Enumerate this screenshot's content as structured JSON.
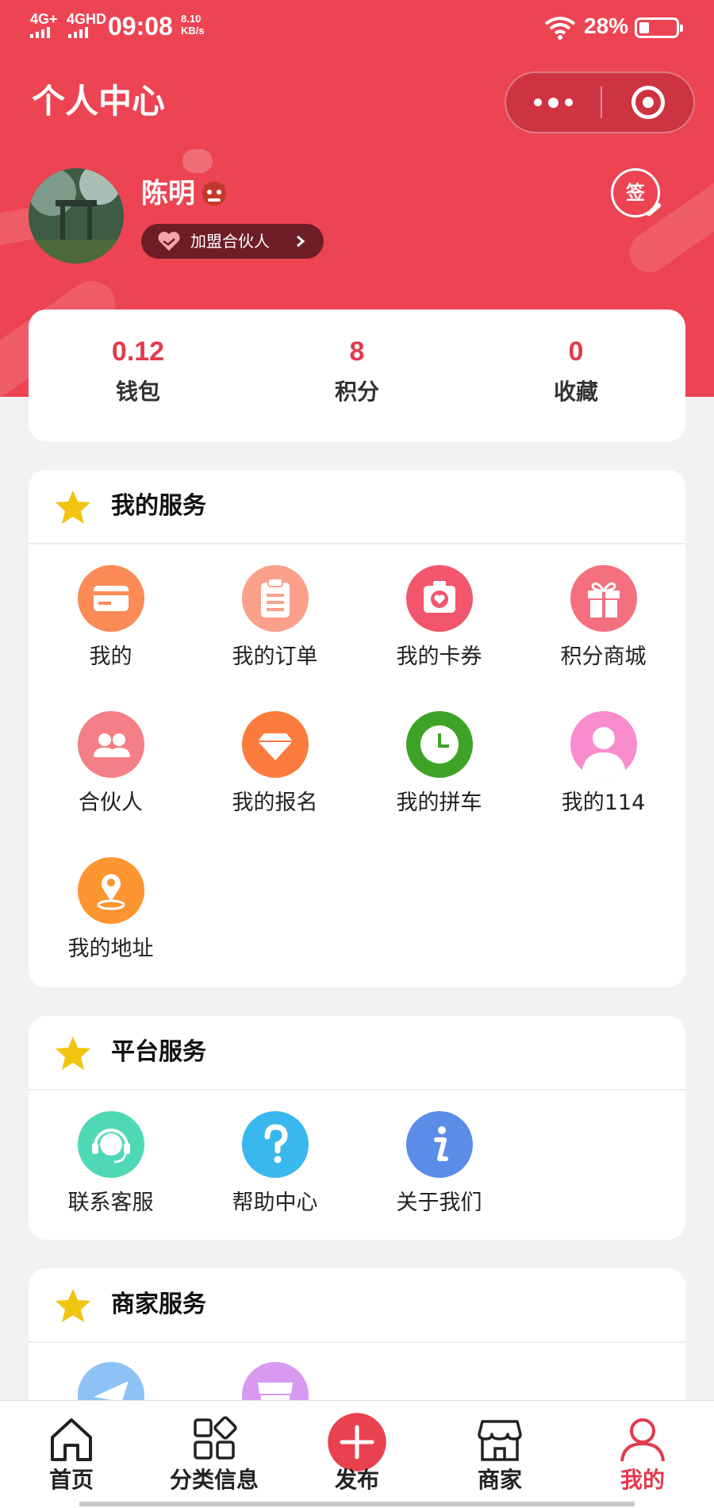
{
  "status_bar": {
    "network1": "4G+",
    "network2": "4GHD",
    "time": "09:08",
    "speed_value": "8.10",
    "speed_unit": "KB/s",
    "battery": "28%",
    "battery_level": 0.28
  },
  "header": {
    "title": "个人中心",
    "capsule_icons": [
      "more-dots-icon",
      "close-target-icon"
    ]
  },
  "profile": {
    "name": "陈明",
    "partner_label": "加盟合伙人",
    "sign_label": "签"
  },
  "stats": [
    {
      "value": "0.12",
      "label": "钱包"
    },
    {
      "value": "8",
      "label": "积分"
    },
    {
      "value": "0",
      "label": "收藏"
    }
  ],
  "my_services": {
    "title": "我的服务",
    "items": [
      {
        "label": "我的",
        "icon": "card-icon",
        "color": "#fc8b56"
      },
      {
        "label": "我的订单",
        "icon": "clipboard-icon",
        "color": "#fba08a"
      },
      {
        "label": "我的卡券",
        "icon": "camera-heart-icon",
        "color": "#f2566c"
      },
      {
        "label": "积分商城",
        "icon": "gift-icon",
        "color": "#f4707e"
      },
      {
        "label": "合伙人",
        "icon": "people-icon",
        "color": "#f57f86"
      },
      {
        "label": "我的报名",
        "icon": "diamond-icon",
        "color": "#fb7c3c"
      },
      {
        "label": "我的拼车",
        "icon": "clock-icon",
        "color": "#3ea326"
      },
      {
        "label": "我的114",
        "icon": "person-icon",
        "color": "#f88ccc"
      },
      {
        "label": "我的地址",
        "icon": "location-pin-icon",
        "color": "#fd9530"
      }
    ]
  },
  "platform_services": {
    "title": "平台服务",
    "items": [
      {
        "label": "联系客服",
        "icon": "headset-icon",
        "color": "#4fd8b5"
      },
      {
        "label": "帮助中心",
        "icon": "question-icon",
        "color": "#39b8ee"
      },
      {
        "label": "关于我们",
        "icon": "info-icon",
        "color": "#5b8de8"
      }
    ]
  },
  "merchant_services": {
    "title": "商家服务",
    "items": [
      {
        "label": "",
        "icon": "paper-plane-icon",
        "color": "#8ec2f6"
      },
      {
        "label": "",
        "icon": "shop-icon",
        "color": "#d89af0"
      }
    ]
  },
  "tabbar": {
    "items": [
      {
        "label": "首页",
        "icon": "home-icon"
      },
      {
        "label": "分类信息",
        "icon": "category-icon"
      },
      {
        "label": "发布",
        "icon": "plus-icon"
      },
      {
        "label": "商家",
        "icon": "store-icon"
      },
      {
        "label": "我的",
        "icon": "user-icon"
      }
    ],
    "active_color": "#e23a4d"
  },
  "colors": {
    "brand": "#ec4452",
    "accent": "#e23a4d",
    "star": "#f1c40f"
  }
}
